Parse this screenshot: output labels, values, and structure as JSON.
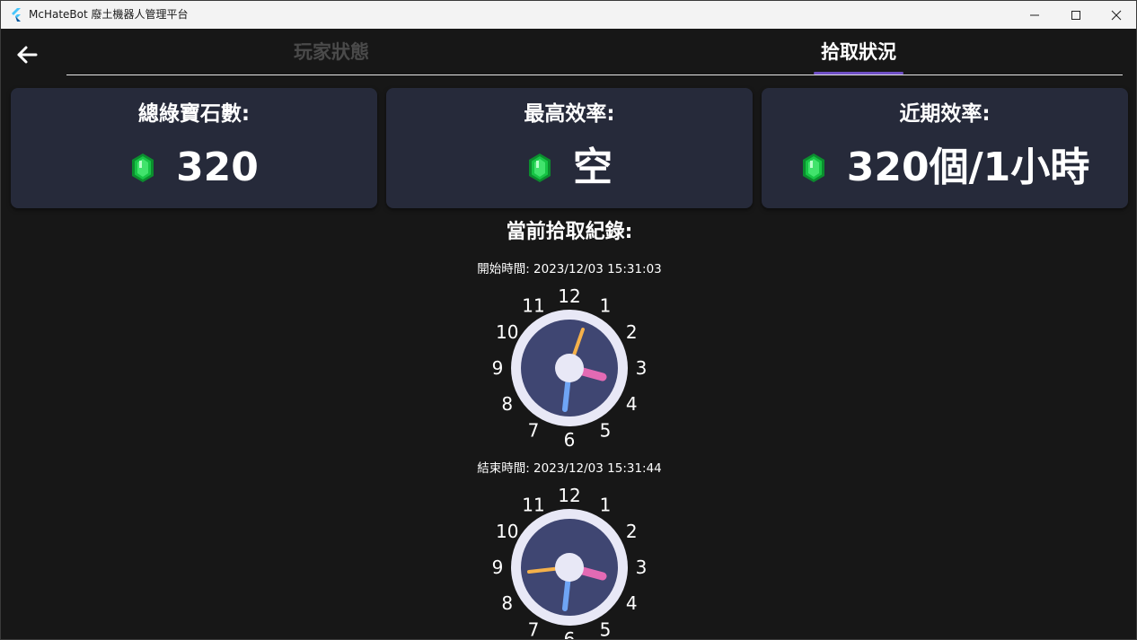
{
  "window": {
    "title": "McHateBot 廢土機器人管理平台",
    "app_icon": "flutter-icon",
    "controls": [
      "minimize-icon",
      "maximize-icon",
      "close-icon"
    ]
  },
  "appbar": {
    "back_icon": "arrow-left-icon",
    "tabs": [
      {
        "label": "玩家狀態",
        "active": false
      },
      {
        "label": "拾取狀況",
        "active": true
      }
    ],
    "indicator_color": "#6f4fc6"
  },
  "stats": [
    {
      "label": "總綠寶石數:",
      "value": "320",
      "icon": "emerald-icon"
    },
    {
      "label": "最高效率:",
      "value": "空",
      "icon": "emerald-icon"
    },
    {
      "label": "近期效率:",
      "value": "320個/1小時",
      "icon": "emerald-icon"
    }
  ],
  "records": {
    "title": "當前拾取紀錄:",
    "start_label": "開始時間: 2023/12/03 15:31:03",
    "end_label": "結束時間: 2023/12/03 15:31:44",
    "clock_numbers": [
      "12",
      "1",
      "2",
      "3",
      "4",
      "5",
      "6",
      "7",
      "8",
      "9",
      "10",
      "11"
    ],
    "clock_colors": {
      "face": "#3f4672",
      "rim": "#e8e8f6",
      "hour": "#e36ab4",
      "minute": "#6fa5f5",
      "second": "#f5b14a"
    }
  }
}
